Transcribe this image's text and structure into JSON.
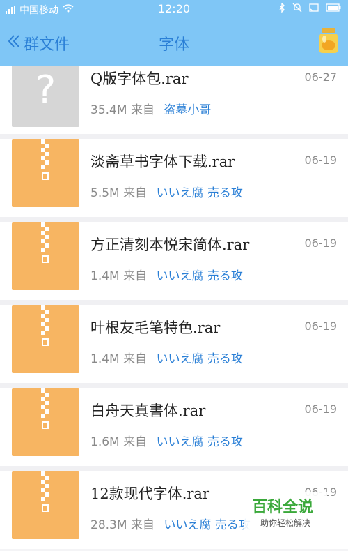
{
  "status_bar": {
    "carrier": "中国移动",
    "time": "12:20"
  },
  "nav": {
    "back_label": "群文件",
    "title": "字体"
  },
  "files": [
    {
      "name": "Q版字体包.rar",
      "date": "06-27",
      "size": "35.4M",
      "from_label": "来自",
      "sender": "盗墓小哥",
      "icon": "unknown-file-icon"
    },
    {
      "name": "淡斋草书字体下载.rar",
      "date": "06-19",
      "size": "5.5M",
      "from_label": "来自",
      "sender": "いいえ腐 売る攻",
      "icon": "zip-file-icon"
    },
    {
      "name": "方正清刻本悦宋简体.rar",
      "date": "06-19",
      "size": "1.4M",
      "from_label": "来自",
      "sender": "いいえ腐 売る攻",
      "icon": "zip-file-icon"
    },
    {
      "name": "叶根友毛笔特色.rar",
      "date": "06-19",
      "size": "1.4M",
      "from_label": "来自",
      "sender": "いいえ腐 売る攻",
      "icon": "zip-file-icon"
    },
    {
      "name": "白舟天真書体.rar",
      "date": "06-19",
      "size": "1.6M",
      "from_label": "来自",
      "sender": "いいえ腐 売る攻",
      "icon": "zip-file-icon"
    },
    {
      "name": "12款现代字体.rar",
      "date": "06-19",
      "size": "28.3M",
      "from_label": "来自",
      "sender": "いいえ腐 売る攻",
      "icon": "zip-file-icon"
    }
  ],
  "watermark": {
    "title": "百科全说",
    "subtitle": "助你轻松解决"
  },
  "colors": {
    "header_bg": "#7fc6f6",
    "accent": "#2a7fd6",
    "zip_icon": "#f7b562"
  }
}
